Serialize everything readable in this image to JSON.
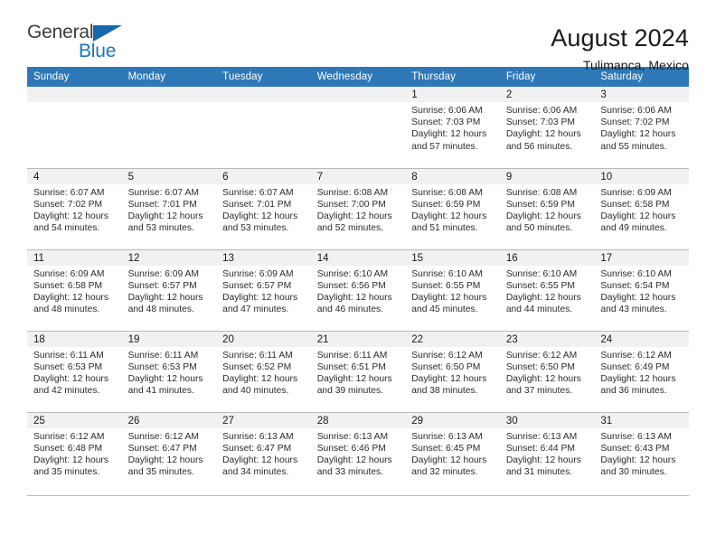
{
  "brand": {
    "name_part1": "General",
    "name_part2": "Blue",
    "triangle_color": "#1668ad",
    "blue_color": "#1a75c2"
  },
  "header": {
    "title": "August 2024",
    "subtitle": "Tulimanca, Mexico"
  },
  "theme": {
    "header_row_bg": "#2e78b8",
    "daynum_band_bg": "#f1f1f1",
    "grid_line": "#b9b9b9",
    "text": "#1a1a1a"
  },
  "weekdays": [
    "Sunday",
    "Monday",
    "Tuesday",
    "Wednesday",
    "Thursday",
    "Friday",
    "Saturday"
  ],
  "weeks": [
    [
      {
        "day": "",
        "empty": true
      },
      {
        "day": "",
        "empty": true
      },
      {
        "day": "",
        "empty": true
      },
      {
        "day": "",
        "empty": true
      },
      {
        "day": "1",
        "sunrise": "Sunrise: 6:06 AM",
        "sunset": "Sunset: 7:03 PM",
        "daylight_line1": "Daylight: 12 hours",
        "daylight_line2": "and 57 minutes."
      },
      {
        "day": "2",
        "sunrise": "Sunrise: 6:06 AM",
        "sunset": "Sunset: 7:03 PM",
        "daylight_line1": "Daylight: 12 hours",
        "daylight_line2": "and 56 minutes."
      },
      {
        "day": "3",
        "sunrise": "Sunrise: 6:06 AM",
        "sunset": "Sunset: 7:02 PM",
        "daylight_line1": "Daylight: 12 hours",
        "daylight_line2": "and 55 minutes."
      }
    ],
    [
      {
        "day": "4",
        "sunrise": "Sunrise: 6:07 AM",
        "sunset": "Sunset: 7:02 PM",
        "daylight_line1": "Daylight: 12 hours",
        "daylight_line2": "and 54 minutes."
      },
      {
        "day": "5",
        "sunrise": "Sunrise: 6:07 AM",
        "sunset": "Sunset: 7:01 PM",
        "daylight_line1": "Daylight: 12 hours",
        "daylight_line2": "and 53 minutes."
      },
      {
        "day": "6",
        "sunrise": "Sunrise: 6:07 AM",
        "sunset": "Sunset: 7:01 PM",
        "daylight_line1": "Daylight: 12 hours",
        "daylight_line2": "and 53 minutes."
      },
      {
        "day": "7",
        "sunrise": "Sunrise: 6:08 AM",
        "sunset": "Sunset: 7:00 PM",
        "daylight_line1": "Daylight: 12 hours",
        "daylight_line2": "and 52 minutes."
      },
      {
        "day": "8",
        "sunrise": "Sunrise: 6:08 AM",
        "sunset": "Sunset: 6:59 PM",
        "daylight_line1": "Daylight: 12 hours",
        "daylight_line2": "and 51 minutes."
      },
      {
        "day": "9",
        "sunrise": "Sunrise: 6:08 AM",
        "sunset": "Sunset: 6:59 PM",
        "daylight_line1": "Daylight: 12 hours",
        "daylight_line2": "and 50 minutes."
      },
      {
        "day": "10",
        "sunrise": "Sunrise: 6:09 AM",
        "sunset": "Sunset: 6:58 PM",
        "daylight_line1": "Daylight: 12 hours",
        "daylight_line2": "and 49 minutes."
      }
    ],
    [
      {
        "day": "11",
        "sunrise": "Sunrise: 6:09 AM",
        "sunset": "Sunset: 6:58 PM",
        "daylight_line1": "Daylight: 12 hours",
        "daylight_line2": "and 48 minutes."
      },
      {
        "day": "12",
        "sunrise": "Sunrise: 6:09 AM",
        "sunset": "Sunset: 6:57 PM",
        "daylight_line1": "Daylight: 12 hours",
        "daylight_line2": "and 48 minutes."
      },
      {
        "day": "13",
        "sunrise": "Sunrise: 6:09 AM",
        "sunset": "Sunset: 6:57 PM",
        "daylight_line1": "Daylight: 12 hours",
        "daylight_line2": "and 47 minutes."
      },
      {
        "day": "14",
        "sunrise": "Sunrise: 6:10 AM",
        "sunset": "Sunset: 6:56 PM",
        "daylight_line1": "Daylight: 12 hours",
        "daylight_line2": "and 46 minutes."
      },
      {
        "day": "15",
        "sunrise": "Sunrise: 6:10 AM",
        "sunset": "Sunset: 6:55 PM",
        "daylight_line1": "Daylight: 12 hours",
        "daylight_line2": "and 45 minutes."
      },
      {
        "day": "16",
        "sunrise": "Sunrise: 6:10 AM",
        "sunset": "Sunset: 6:55 PM",
        "daylight_line1": "Daylight: 12 hours",
        "daylight_line2": "and 44 minutes."
      },
      {
        "day": "17",
        "sunrise": "Sunrise: 6:10 AM",
        "sunset": "Sunset: 6:54 PM",
        "daylight_line1": "Daylight: 12 hours",
        "daylight_line2": "and 43 minutes."
      }
    ],
    [
      {
        "day": "18",
        "sunrise": "Sunrise: 6:11 AM",
        "sunset": "Sunset: 6:53 PM",
        "daylight_line1": "Daylight: 12 hours",
        "daylight_line2": "and 42 minutes."
      },
      {
        "day": "19",
        "sunrise": "Sunrise: 6:11 AM",
        "sunset": "Sunset: 6:53 PM",
        "daylight_line1": "Daylight: 12 hours",
        "daylight_line2": "and 41 minutes."
      },
      {
        "day": "20",
        "sunrise": "Sunrise: 6:11 AM",
        "sunset": "Sunset: 6:52 PM",
        "daylight_line1": "Daylight: 12 hours",
        "daylight_line2": "and 40 minutes."
      },
      {
        "day": "21",
        "sunrise": "Sunrise: 6:11 AM",
        "sunset": "Sunset: 6:51 PM",
        "daylight_line1": "Daylight: 12 hours",
        "daylight_line2": "and 39 minutes."
      },
      {
        "day": "22",
        "sunrise": "Sunrise: 6:12 AM",
        "sunset": "Sunset: 6:50 PM",
        "daylight_line1": "Daylight: 12 hours",
        "daylight_line2": "and 38 minutes."
      },
      {
        "day": "23",
        "sunrise": "Sunrise: 6:12 AM",
        "sunset": "Sunset: 6:50 PM",
        "daylight_line1": "Daylight: 12 hours",
        "daylight_line2": "and 37 minutes."
      },
      {
        "day": "24",
        "sunrise": "Sunrise: 6:12 AM",
        "sunset": "Sunset: 6:49 PM",
        "daylight_line1": "Daylight: 12 hours",
        "daylight_line2": "and 36 minutes."
      }
    ],
    [
      {
        "day": "25",
        "sunrise": "Sunrise: 6:12 AM",
        "sunset": "Sunset: 6:48 PM",
        "daylight_line1": "Daylight: 12 hours",
        "daylight_line2": "and 35 minutes."
      },
      {
        "day": "26",
        "sunrise": "Sunrise: 6:12 AM",
        "sunset": "Sunset: 6:47 PM",
        "daylight_line1": "Daylight: 12 hours",
        "daylight_line2": "and 35 minutes."
      },
      {
        "day": "27",
        "sunrise": "Sunrise: 6:13 AM",
        "sunset": "Sunset: 6:47 PM",
        "daylight_line1": "Daylight: 12 hours",
        "daylight_line2": "and 34 minutes."
      },
      {
        "day": "28",
        "sunrise": "Sunrise: 6:13 AM",
        "sunset": "Sunset: 6:46 PM",
        "daylight_line1": "Daylight: 12 hours",
        "daylight_line2": "and 33 minutes."
      },
      {
        "day": "29",
        "sunrise": "Sunrise: 6:13 AM",
        "sunset": "Sunset: 6:45 PM",
        "daylight_line1": "Daylight: 12 hours",
        "daylight_line2": "and 32 minutes."
      },
      {
        "day": "30",
        "sunrise": "Sunrise: 6:13 AM",
        "sunset": "Sunset: 6:44 PM",
        "daylight_line1": "Daylight: 12 hours",
        "daylight_line2": "and 31 minutes."
      },
      {
        "day": "31",
        "sunrise": "Sunrise: 6:13 AM",
        "sunset": "Sunset: 6:43 PM",
        "daylight_line1": "Daylight: 12 hours",
        "daylight_line2": "and 30 minutes."
      }
    ]
  ]
}
